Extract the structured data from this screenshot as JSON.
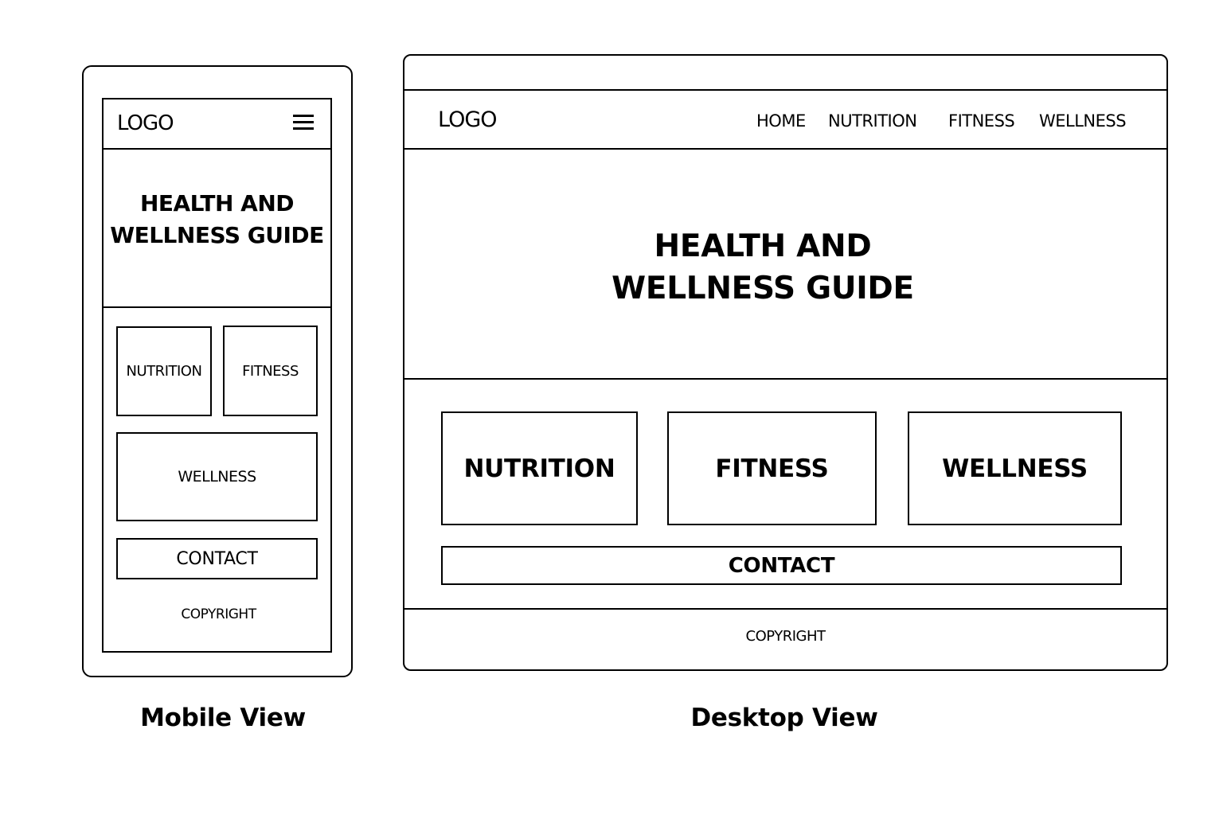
{
  "mobile": {
    "logo": "LOGO",
    "menu_icon": "hamburger-menu-icon",
    "title": "HEALTH AND WELLNESS GUIDE",
    "cards": [
      "NUTRITION",
      "FITNESS",
      "WELLNESS"
    ],
    "contact": "CONTACT",
    "copyright": "COPYRIGHT",
    "caption": "Mobile View"
  },
  "desktop": {
    "logo": "LOGO",
    "nav": [
      "HOME",
      "NUTRITION",
      "FITNESS",
      "WELLNESS"
    ],
    "title": "HEALTH AND WELLNESS GUIDE",
    "cards": [
      "NUTRITION",
      "FITNESS",
      "WELLNESS"
    ],
    "contact": "CONTACT",
    "copyright": "COPYRIGHT",
    "caption": "Desktop View"
  },
  "colors": {
    "stroke": "#000000",
    "background": "#ffffff"
  }
}
